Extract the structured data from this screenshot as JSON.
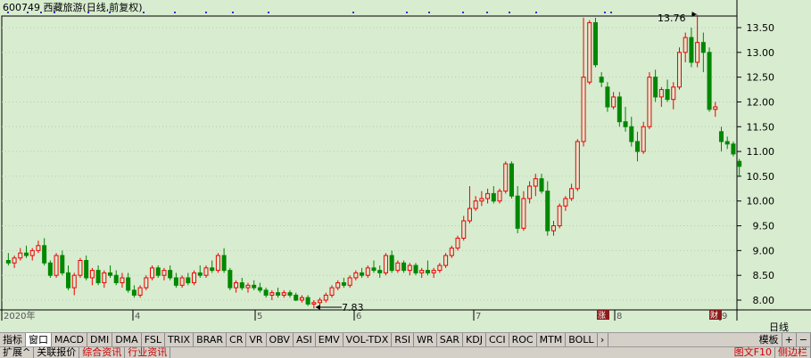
{
  "header": {
    "title": "600749 西藏旅游(日线,前复权)"
  },
  "chart_data": {
    "type": "candlestick",
    "title": "600749 西藏旅游(日线,前复权)",
    "y_ticks": [
      "13.50",
      "13.00",
      "12.50",
      "12.00",
      "11.50",
      "11.00",
      "10.50",
      "10.00",
      "9.50",
      "9.00",
      "8.50",
      "8.00"
    ],
    "ylim": [
      7.6,
      13.85
    ],
    "x_labels": [
      "2020年",
      "4",
      "5",
      "6",
      "7",
      "8",
      "9"
    ],
    "annotations": {
      "high": "13.76",
      "low": "7.83"
    },
    "event_markers": [
      "涨",
      "财"
    ],
    "colors": {
      "up": "#ee0000",
      "down": "#008800",
      "background": "#d8ecd0",
      "axis": "#000000"
    },
    "candles": [
      [
        8.8,
        8.95,
        8.7,
        8.75
      ],
      [
        8.75,
        8.9,
        8.65,
        8.85
      ],
      [
        8.85,
        9.05,
        8.8,
        8.95
      ],
      [
        8.95,
        9.1,
        8.85,
        8.9
      ],
      [
        8.9,
        9.05,
        8.8,
        9.0
      ],
      [
        9.0,
        9.2,
        8.95,
        9.1
      ],
      [
        9.1,
        9.25,
        8.7,
        8.75
      ],
      [
        8.75,
        8.8,
        8.45,
        8.5
      ],
      [
        8.5,
        8.95,
        8.45,
        8.9
      ],
      [
        8.9,
        9.0,
        8.5,
        8.55
      ],
      [
        8.55,
        8.7,
        8.2,
        8.25
      ],
      [
        8.25,
        8.55,
        8.1,
        8.5
      ],
      [
        8.5,
        8.85,
        8.45,
        8.8
      ],
      [
        8.8,
        8.9,
        8.4,
        8.45
      ],
      [
        8.45,
        8.65,
        8.3,
        8.6
      ],
      [
        8.6,
        8.7,
        8.3,
        8.35
      ],
      [
        8.35,
        8.6,
        8.25,
        8.55
      ],
      [
        8.55,
        8.7,
        8.45,
        8.5
      ],
      [
        8.5,
        8.6,
        8.3,
        8.35
      ],
      [
        8.35,
        8.55,
        8.25,
        8.45
      ],
      [
        8.45,
        8.55,
        8.15,
        8.2
      ],
      [
        8.2,
        8.3,
        8.05,
        8.1
      ],
      [
        8.1,
        8.3,
        8.05,
        8.25
      ],
      [
        8.25,
        8.5,
        8.2,
        8.45
      ],
      [
        8.45,
        8.7,
        8.4,
        8.65
      ],
      [
        8.65,
        8.7,
        8.45,
        8.5
      ],
      [
        8.5,
        8.65,
        8.4,
        8.6
      ],
      [
        8.6,
        8.7,
        8.4,
        8.45
      ],
      [
        8.45,
        8.55,
        8.25,
        8.3
      ],
      [
        8.3,
        8.5,
        8.25,
        8.45
      ],
      [
        8.45,
        8.55,
        8.3,
        8.35
      ],
      [
        8.35,
        8.6,
        8.3,
        8.55
      ],
      [
        8.55,
        8.7,
        8.45,
        8.5
      ],
      [
        8.5,
        8.7,
        8.45,
        8.65
      ],
      [
        8.65,
        8.8,
        8.55,
        8.6
      ],
      [
        8.6,
        8.95,
        8.55,
        8.9
      ],
      [
        8.9,
        9.05,
        8.55,
        8.6
      ],
      [
        8.6,
        8.65,
        8.2,
        8.25
      ],
      [
        8.25,
        8.4,
        8.15,
        8.35
      ],
      [
        8.35,
        8.45,
        8.2,
        8.25
      ],
      [
        8.25,
        8.35,
        8.15,
        8.3
      ],
      [
        8.3,
        8.4,
        8.2,
        8.25
      ],
      [
        8.25,
        8.35,
        8.15,
        8.2
      ],
      [
        8.2,
        8.25,
        8.05,
        8.1
      ],
      [
        8.1,
        8.2,
        8.0,
        8.15
      ],
      [
        8.15,
        8.25,
        8.05,
        8.1
      ],
      [
        8.1,
        8.2,
        8.05,
        8.15
      ],
      [
        8.15,
        8.2,
        8.05,
        8.1
      ],
      [
        8.1,
        8.15,
        7.98,
        8.0
      ],
      [
        8.0,
        8.1,
        7.95,
        8.05
      ],
      [
        8.05,
        8.1,
        7.88,
        7.92
      ],
      [
        7.92,
        8.0,
        7.83,
        7.95
      ],
      [
        7.95,
        8.05,
        7.9,
        8.0
      ],
      [
        8.0,
        8.15,
        7.95,
        8.1
      ],
      [
        8.1,
        8.3,
        8.05,
        8.25
      ],
      [
        8.25,
        8.4,
        8.2,
        8.35
      ],
      [
        8.35,
        8.45,
        8.25,
        8.3
      ],
      [
        8.3,
        8.5,
        8.25,
        8.45
      ],
      [
        8.45,
        8.6,
        8.4,
        8.55
      ],
      [
        8.55,
        8.65,
        8.45,
        8.5
      ],
      [
        8.5,
        8.7,
        8.45,
        8.65
      ],
      [
        8.65,
        8.8,
        8.55,
        8.6
      ],
      [
        8.6,
        8.7,
        8.45,
        8.55
      ],
      [
        8.55,
        8.95,
        8.5,
        8.9
      ],
      [
        8.9,
        9.0,
        8.55,
        8.6
      ],
      [
        8.6,
        8.8,
        8.55,
        8.75
      ],
      [
        8.75,
        8.8,
        8.55,
        8.6
      ],
      [
        8.6,
        8.75,
        8.5,
        8.7
      ],
      [
        8.7,
        8.75,
        8.5,
        8.55
      ],
      [
        8.55,
        8.65,
        8.45,
        8.6
      ],
      [
        8.6,
        8.8,
        8.5,
        8.55
      ],
      [
        8.55,
        8.65,
        8.45,
        8.6
      ],
      [
        8.6,
        8.75,
        8.55,
        8.7
      ],
      [
        8.7,
        8.95,
        8.65,
        8.9
      ],
      [
        8.9,
        9.1,
        8.85,
        9.05
      ],
      [
        9.05,
        9.3,
        9.0,
        9.25
      ],
      [
        9.25,
        9.7,
        9.2,
        9.6
      ],
      [
        9.6,
        10.3,
        9.55,
        9.85
      ],
      [
        9.85,
        10.1,
        9.8,
        10.0
      ],
      [
        10.0,
        10.2,
        9.9,
        10.05
      ],
      [
        10.05,
        10.25,
        9.95,
        10.15
      ],
      [
        10.15,
        10.3,
        9.95,
        10.0
      ],
      [
        10.0,
        10.25,
        9.95,
        10.2
      ],
      [
        10.2,
        10.8,
        10.15,
        10.75
      ],
      [
        10.75,
        10.8,
        10.05,
        10.1
      ],
      [
        10.1,
        10.3,
        9.35,
        9.45
      ],
      [
        9.45,
        10.2,
        9.4,
        10.05
      ],
      [
        10.05,
        10.4,
        9.95,
        10.3
      ],
      [
        10.3,
        10.55,
        10.1,
        10.45
      ],
      [
        10.45,
        10.55,
        10.15,
        10.2
      ],
      [
        10.2,
        10.4,
        9.3,
        9.4
      ],
      [
        9.4,
        9.6,
        9.3,
        9.5
      ],
      [
        9.5,
        9.95,
        9.45,
        9.9
      ],
      [
        9.9,
        10.1,
        9.8,
        10.05
      ],
      [
        10.05,
        10.35,
        10.0,
        10.25
      ],
      [
        10.25,
        11.25,
        10.2,
        11.2
      ],
      [
        11.2,
        13.7,
        11.1,
        12.5
      ],
      [
        12.4,
        13.65,
        12.35,
        13.6
      ],
      [
        13.6,
        13.7,
        12.7,
        12.75
      ],
      [
        12.5,
        12.6,
        12.3,
        12.4
      ],
      [
        12.3,
        12.4,
        11.8,
        11.9
      ],
      [
        11.9,
        12.2,
        11.85,
        12.1
      ],
      [
        12.1,
        12.2,
        11.5,
        11.6
      ],
      [
        11.6,
        11.9,
        11.4,
        11.5
      ],
      [
        11.5,
        11.7,
        11.1,
        11.2
      ],
      [
        11.2,
        11.4,
        10.8,
        11.0
      ],
      [
        11.0,
        11.6,
        10.95,
        11.5
      ],
      [
        11.5,
        12.6,
        11.45,
        12.5
      ],
      [
        12.5,
        12.65,
        12.0,
        12.1
      ],
      [
        12.1,
        12.3,
        11.9,
        12.25
      ],
      [
        12.25,
        12.45,
        12.0,
        12.05
      ],
      [
        12.05,
        12.4,
        11.85,
        12.3
      ],
      [
        12.3,
        13.1,
        12.25,
        13.0
      ],
      [
        13.0,
        13.4,
        12.8,
        13.3
      ],
      [
        13.3,
        13.5,
        12.7,
        12.8
      ],
      [
        12.8,
        13.76,
        12.7,
        13.2
      ],
      [
        13.2,
        13.4,
        12.6,
        13.0
      ],
      [
        13.0,
        13.1,
        11.8,
        11.85
      ],
      [
        11.85,
        12.0,
        11.7,
        11.9
      ],
      [
        11.4,
        11.5,
        11.0,
        11.2
      ],
      [
        11.2,
        11.3,
        11.05,
        11.15
      ],
      [
        11.15,
        11.2,
        10.9,
        10.95
      ],
      [
        10.8,
        10.85,
        10.5,
        10.7
      ]
    ]
  },
  "toolbar": {
    "tabs": [
      "指标",
      "窗口",
      "MACD",
      "DMI",
      "DMA",
      "FSL",
      "TRIX",
      "BRAR",
      "CR",
      "VR",
      "OBV",
      "ASI",
      "EMV",
      "VOL-TDX",
      "RSI",
      "WR",
      "SAR",
      "KDJ",
      "CCI",
      "ROC",
      "MTM",
      "BOLL"
    ],
    "more_arrow": "›",
    "template_label": "模板",
    "plus": "+",
    "minus": "−"
  },
  "period_label": "日线",
  "bottombar": {
    "left_tabs": [
      "扩展^",
      "关联报价"
    ],
    "red_tabs": [
      "综合资讯",
      "行业资讯"
    ],
    "right_tabs": [
      "图文F10",
      "侧边栏"
    ]
  }
}
